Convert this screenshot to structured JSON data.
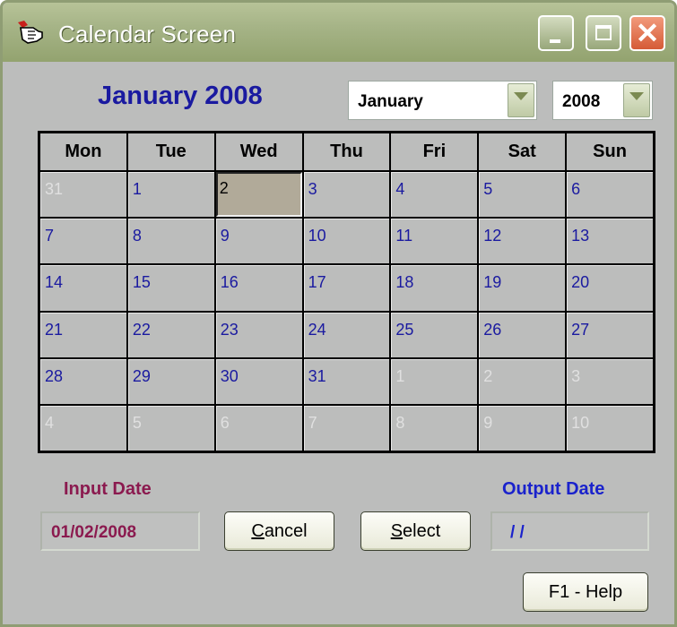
{
  "window": {
    "title": "Calendar Screen"
  },
  "calendar": {
    "heading": "January 2008",
    "month_select": "January",
    "year_select": "2008",
    "weekdays": [
      "Mon",
      "Tue",
      "Wed",
      "Thu",
      "Fri",
      "Sat",
      "Sun"
    ],
    "days": [
      {
        "n": "31",
        "cur": false
      },
      {
        "n": "1",
        "cur": true
      },
      {
        "n": "2",
        "cur": true,
        "selected": true
      },
      {
        "n": "3",
        "cur": true
      },
      {
        "n": "4",
        "cur": true
      },
      {
        "n": "5",
        "cur": true
      },
      {
        "n": "6",
        "cur": true
      },
      {
        "n": "7",
        "cur": true
      },
      {
        "n": "8",
        "cur": true
      },
      {
        "n": "9",
        "cur": true
      },
      {
        "n": "10",
        "cur": true
      },
      {
        "n": "11",
        "cur": true
      },
      {
        "n": "12",
        "cur": true
      },
      {
        "n": "13",
        "cur": true
      },
      {
        "n": "14",
        "cur": true
      },
      {
        "n": "15",
        "cur": true
      },
      {
        "n": "16",
        "cur": true
      },
      {
        "n": "17",
        "cur": true
      },
      {
        "n": "18",
        "cur": true
      },
      {
        "n": "19",
        "cur": true
      },
      {
        "n": "20",
        "cur": true
      },
      {
        "n": "21",
        "cur": true
      },
      {
        "n": "22",
        "cur": true
      },
      {
        "n": "23",
        "cur": true
      },
      {
        "n": "24",
        "cur": true
      },
      {
        "n": "25",
        "cur": true
      },
      {
        "n": "26",
        "cur": true
      },
      {
        "n": "27",
        "cur": true
      },
      {
        "n": "28",
        "cur": true
      },
      {
        "n": "29",
        "cur": true
      },
      {
        "n": "30",
        "cur": true
      },
      {
        "n": "31",
        "cur": true
      },
      {
        "n": "1",
        "cur": false
      },
      {
        "n": "2",
        "cur": false
      },
      {
        "n": "3",
        "cur": false
      },
      {
        "n": "4",
        "cur": false
      },
      {
        "n": "5",
        "cur": false
      },
      {
        "n": "6",
        "cur": false
      },
      {
        "n": "7",
        "cur": false
      },
      {
        "n": "8",
        "cur": false
      },
      {
        "n": "9",
        "cur": false
      },
      {
        "n": "10",
        "cur": false
      }
    ]
  },
  "input_date": {
    "label": "Input Date",
    "value": "01/02/2008"
  },
  "output_date": {
    "label": "Output Date",
    "value": "/ /"
  },
  "buttons": {
    "cancel": {
      "mnemonic": "C",
      "rest": "ancel"
    },
    "select": {
      "mnemonic": "S",
      "rest": "elect"
    },
    "help": "F1 - Help"
  },
  "colors": {
    "accent_blue": "#1a1aa0",
    "input_label": "#8b1a4f",
    "output_label": "#1a22cc",
    "titlebar": "#a6b487"
  },
  "icons": {
    "app": "pointing-hand-icon",
    "minimize": "minimize-icon",
    "maximize": "maximize-icon",
    "close": "close-icon"
  }
}
